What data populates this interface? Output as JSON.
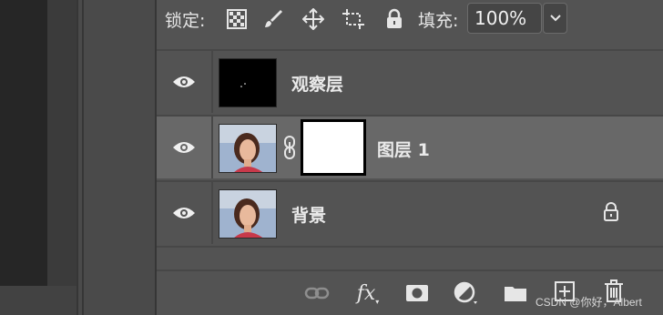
{
  "lock_row": {
    "lock_label": "锁定:",
    "lock_icons": [
      "lock-transparent-pixels-icon",
      "lock-image-pixels-icon",
      "lock-position-icon",
      "lock-artboard-icon",
      "lock-all-icon"
    ],
    "fill_label": "填充:",
    "fill_value": "100%"
  },
  "layers": [
    {
      "name": "观察层",
      "visible": true,
      "thumbnail": "black-thumbnail"
    },
    {
      "name": "图层 1",
      "visible": true,
      "thumbnail": "portrait-thumbnail",
      "has_mask": true,
      "selected": true
    },
    {
      "name": "背景",
      "visible": true,
      "thumbnail": "portrait-thumbnail",
      "locked": true
    }
  ],
  "bottom_toolbar": {
    "icons": [
      "link-layers-icon",
      "layer-style-fx-icon",
      "add-mask-icon",
      "adjustment-layer-icon",
      "new-group-icon",
      "new-layer-icon",
      "delete-layer-icon"
    ],
    "fx_label": "fx"
  },
  "watermark": "CSDN @你好，Albert",
  "colors": {
    "panel_bg": "#535353",
    "selected_row": "#686868",
    "text": "#eaeaea"
  }
}
